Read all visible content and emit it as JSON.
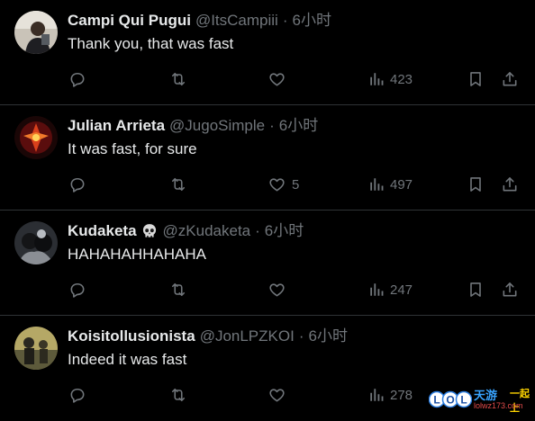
{
  "colors": {
    "background": "#000000",
    "text_primary": "#e7e9ea",
    "text_secondary": "#71767b",
    "divider": "#2f3336"
  },
  "icons": {
    "reply": "reply-icon",
    "retweet": "retweet-icon",
    "like": "heart-icon",
    "views": "views-bar-chart-icon",
    "bookmark": "bookmark-icon",
    "share": "share-upload-icon"
  },
  "tweets": [
    {
      "name": "Campi Qui Pugui",
      "handle": "@ItsCampiii",
      "separator": "·",
      "time": "6小时",
      "text": "Thank you, that was fast",
      "likes": "",
      "views": "423"
    },
    {
      "name": "Julian Arrieta",
      "handle": "@JugoSimple",
      "separator": "·",
      "time": "6小时",
      "text": "It was fast, for sure",
      "likes": "5",
      "views": "497"
    },
    {
      "name": "Kudaketa",
      "name_badge": "skull-emoji",
      "handle": "@zKudaketa",
      "separator": "·",
      "time": "6小时",
      "text": "HAHAHAHHAHAHA",
      "likes": "",
      "views": "247"
    },
    {
      "name": "Koisitollusionista",
      "handle": "@JonLPZKOI",
      "separator": "·",
      "time": "6小时",
      "text": "Indeed it was fast",
      "likes": "",
      "views": "278"
    }
  ],
  "watermark": {
    "logo": "LOL",
    "title": "天游",
    "title2": "一起上",
    "url": "lolwz173.com"
  }
}
